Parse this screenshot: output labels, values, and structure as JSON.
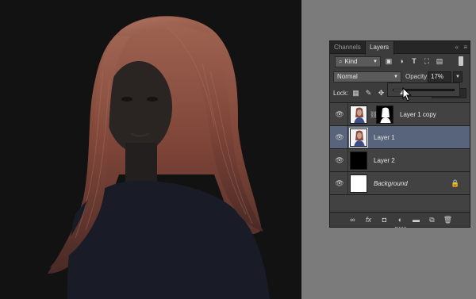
{
  "panel": {
    "tabs": [
      {
        "label": "Channels"
      },
      {
        "label": "Layers"
      }
    ],
    "close_glyph": "«",
    "menu_glyph": "≡"
  },
  "filter": {
    "kind_label": "Kind",
    "kind_prefix": "⌕"
  },
  "blend": {
    "mode": "Normal",
    "opacity_label": "Opacity:",
    "opacity_value": "17%",
    "opacity_fraction": 0.17
  },
  "lock": {
    "label": "Lock:"
  },
  "layers": [
    {
      "name": "Layer 1 copy",
      "selected": false,
      "has_mask": true,
      "thumb": "photo",
      "italic": false,
      "locked": false
    },
    {
      "name": "Layer 1",
      "selected": true,
      "has_mask": false,
      "thumb": "photo",
      "italic": false,
      "locked": false
    },
    {
      "name": "Layer 2",
      "selected": false,
      "has_mask": false,
      "thumb": "black",
      "italic": false,
      "locked": false
    },
    {
      "name": "Background",
      "selected": false,
      "has_mask": false,
      "thumb": "white",
      "italic": true,
      "locked": true
    }
  ],
  "colors": {
    "selected_row": "#57647c",
    "panel_bg": "#3c3c3c",
    "canvas_bg": "#121212",
    "workspace_bg": "#7b7b7b",
    "hair": "#8a4a3e"
  },
  "footer_icons": [
    "link-icon",
    "fx-icon",
    "mask-icon",
    "adjustment-icon",
    "folder-icon",
    "new-layer-icon",
    "trash-icon"
  ]
}
